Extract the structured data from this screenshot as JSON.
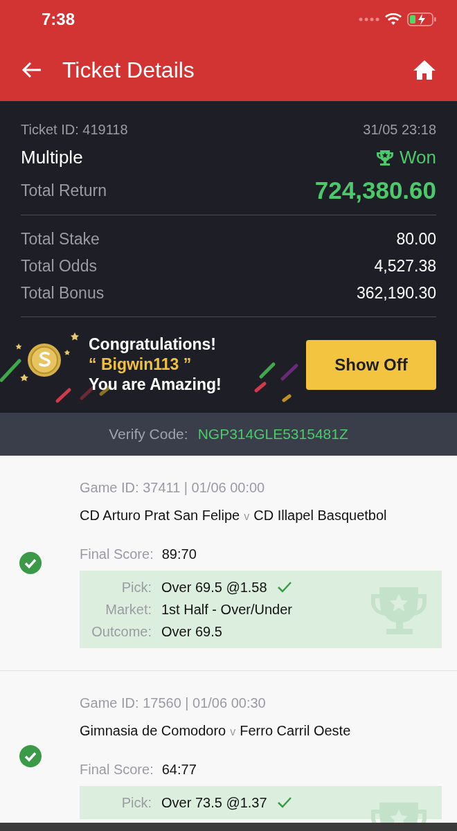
{
  "status_bar": {
    "time": "7:38"
  },
  "header": {
    "title": "Ticket Details"
  },
  "ticket": {
    "id": "Ticket ID: 419118",
    "datetime": "31/05 23:18",
    "type": "Multiple",
    "status": {
      "kind": "won",
      "label": "Won"
    },
    "return_label": "Total Return",
    "return_value": "724,380.60",
    "rows": [
      {
        "label": "Total Stake",
        "value": "80.00"
      },
      {
        "label": "Total Odds",
        "value": "4,527.38"
      },
      {
        "label": "Total Bonus",
        "value": "362,190.30"
      }
    ]
  },
  "banner": {
    "line_1": "Congratulations!",
    "username": "“ Bigwin113 ”",
    "line_3": "You are Amazing!",
    "button": "Show Off"
  },
  "verify": {
    "label": "Verify Code:",
    "code": "NGP314GLE5315481Z"
  },
  "games": [
    {
      "game_id": "Game ID: 37411 | 01/06 00:00",
      "home": "CD Arturo Prat San Felipe",
      "vs": "v",
      "away": "CD Illapel Basquetbol",
      "won": true,
      "score_label": "Final Score:",
      "score": "89:70",
      "details": [
        {
          "label": "Pick:",
          "value": "Over 69.5 @1.58",
          "checked": true
        },
        {
          "label": "Market:",
          "value": "1st Half - Over/Under",
          "checked": false
        },
        {
          "label": "Outcome:",
          "value": "Over 69.5",
          "checked": false
        }
      ]
    },
    {
      "game_id": "Game ID: 17560 | 01/06 00:30",
      "home": "Gimnasia de Comodoro",
      "vs": "v",
      "away": "Ferro Carril Oeste",
      "won": true,
      "score_label": "Final Score:",
      "score": "64:77",
      "details": [
        {
          "label": "Pick:",
          "value": "Over 73.5 @1.37",
          "checked": true
        }
      ]
    }
  ]
}
